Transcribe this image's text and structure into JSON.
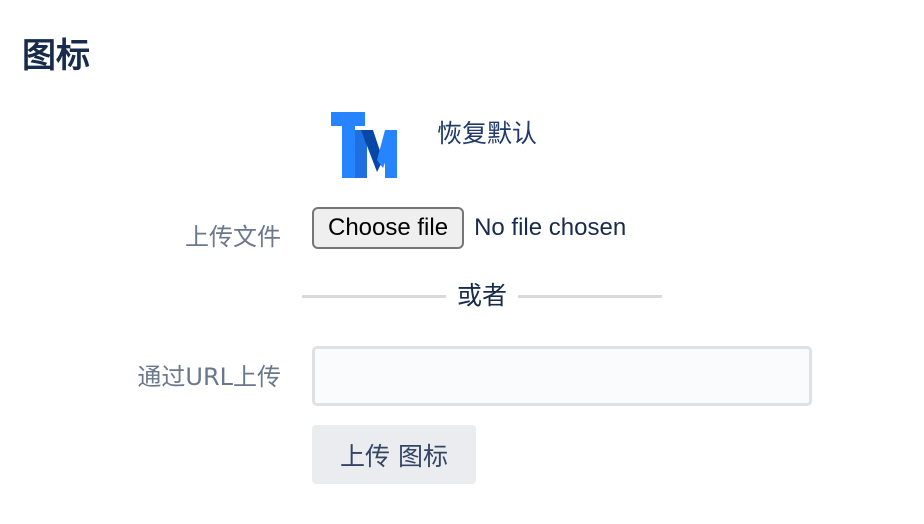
{
  "page": {
    "title": "图标"
  },
  "logo": {
    "icon": "tm-logo-icon",
    "letters": "TM",
    "colors": {
      "primary": "#2684FF",
      "dark": "#0747A6"
    }
  },
  "reset": {
    "label": "恢复默认"
  },
  "upload_file": {
    "label": "上传文件",
    "button_label": "Choose file",
    "status": "No file chosen"
  },
  "divider": {
    "label": "或者"
  },
  "upload_url": {
    "label": "通过URL上传",
    "value": "",
    "placeholder": ""
  },
  "submit": {
    "label": "上传 图标"
  }
}
